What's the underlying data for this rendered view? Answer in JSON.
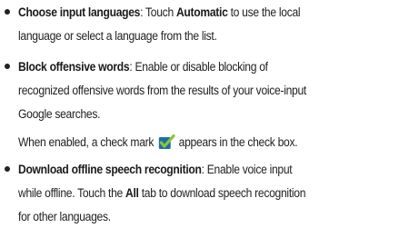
{
  "items": [
    {
      "title": "Choose input languages",
      "line1_a": ": Touch ",
      "line1_b": "Automatic",
      "line1_c": " to use the local",
      "line2": "language or select a language from the list."
    },
    {
      "title": "Block offensive words",
      "line1": ": Enable or disable blocking of",
      "line2": "recognized offensive words from the results of your voice-input",
      "line3": "Google searches.",
      "note_before": "When enabled, a check mark",
      "note_after": "appears in the check box."
    },
    {
      "title": "Download offline speech recognition",
      "line1": ": Enable voice input",
      "line2_a": "while offline. Touch the ",
      "line2_b": "All",
      "line2_c": " tab to download speech recognition",
      "line3": "for other languages."
    }
  ],
  "icons": {
    "check": "check-mark-icon"
  },
  "colors": {
    "text": "#222222",
    "check_box": "#1f6f9e",
    "check_mark": "#8ac43f"
  }
}
